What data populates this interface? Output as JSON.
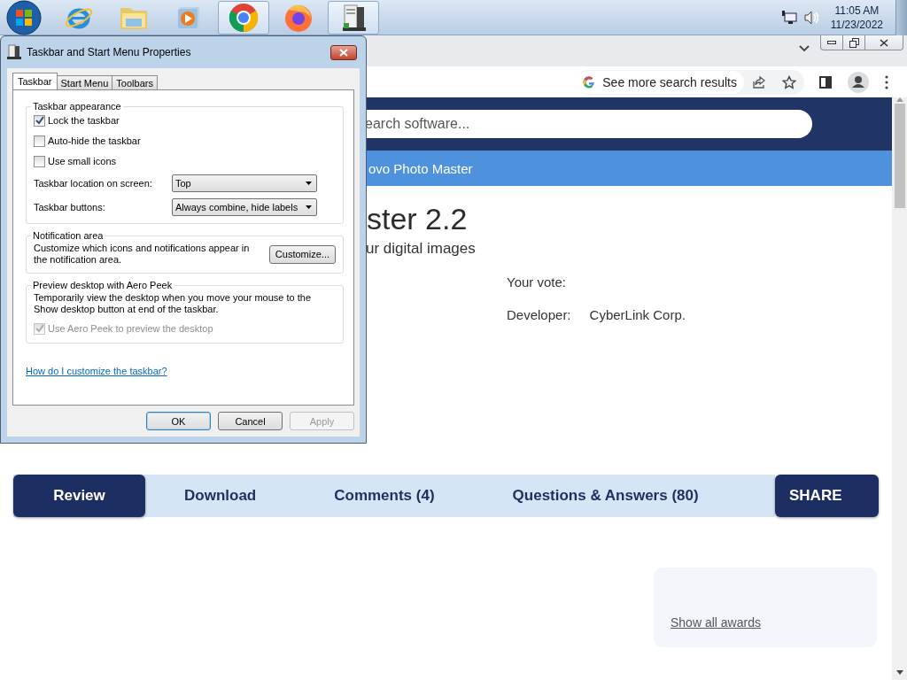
{
  "taskbar": {
    "apps": [
      {
        "kind": "ie",
        "open": false
      },
      {
        "kind": "explorer",
        "open": false
      },
      {
        "kind": "media",
        "open": false
      },
      {
        "kind": "chrome",
        "open": true
      },
      {
        "kind": "firefox",
        "open": false
      },
      {
        "kind": "settings",
        "open": true
      }
    ],
    "clock": {
      "time": "11:05 AM",
      "date": "11/23/2022"
    }
  },
  "dialog": {
    "title": "Taskbar and Start Menu Properties",
    "tabs": [
      {
        "label": "Taskbar",
        "selected": true
      },
      {
        "label": "Start Menu",
        "selected": false
      },
      {
        "label": "Toolbars",
        "selected": false
      }
    ],
    "appearance": {
      "heading": "Taskbar appearance",
      "checkboxes": [
        {
          "label": "Lock the taskbar",
          "checked": true
        },
        {
          "label": "Auto-hide the taskbar",
          "checked": false
        },
        {
          "label": "Use small icons",
          "checked": false
        }
      ],
      "dropdowns": [
        {
          "label": "Taskbar location on screen:",
          "value": "Top"
        },
        {
          "label": "Taskbar buttons:",
          "value": "Always combine, hide labels"
        }
      ]
    },
    "notification": {
      "heading": "Notification area",
      "text": "Customize which icons and notifications appear in the notification area.",
      "button": "Customize..."
    },
    "aero_peek": {
      "heading": "Preview desktop with Aero Peek",
      "text": "Temporarily view the desktop when you move your mouse to the Show desktop button at end of the taskbar.",
      "checkbox": {
        "label": "Use Aero Peek to preview the desktop",
        "checked": true,
        "disabled": true
      }
    },
    "help_link": "How do I customize the taskbar?",
    "buttons": [
      {
        "label": "OK",
        "disabled": false
      },
      {
        "label": "Cancel",
        "disabled": false
      },
      {
        "label": "Apply",
        "disabled": true
      }
    ]
  },
  "browser": {
    "search_chip": "See more search results",
    "page": {
      "search_placeholder": "earch software...",
      "nav_item": "ovo Photo Master",
      "title": "ster 2.2",
      "subtitle": "ur digital images",
      "vote_label": "Your vote:",
      "developer_label": "Developer:",
      "developer": "CyberLink Corp.",
      "tabs": [
        {
          "label": "Review",
          "selected": true
        },
        {
          "label": "Download",
          "selected": false
        },
        {
          "label": "Comments (4)",
          "selected": false
        },
        {
          "label": "Questions & Answers (80)",
          "selected": false
        }
      ],
      "share": "SHARE",
      "awards_link": "Show all awards"
    }
  }
}
